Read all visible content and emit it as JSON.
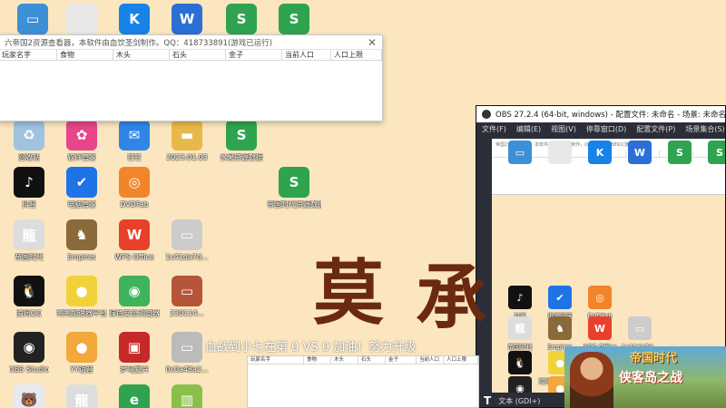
{
  "desktop": {
    "icons_top": [
      {
        "name": "computer-icon",
        "label": "",
        "color": "#3d8fd6",
        "glyph": "▭"
      },
      {
        "name": "file-icon",
        "label": "",
        "color": "#e8e8e8",
        "glyph": ""
      },
      {
        "name": "k-app-icon",
        "label": "",
        "color": "#1783e8",
        "glyph": "K"
      },
      {
        "name": "word-doc-icon",
        "label": "",
        "color": "#2b6fd6",
        "glyph": "W"
      },
      {
        "name": "spreadsheet-icon",
        "label": "",
        "color": "#2fa34f",
        "glyph": "S"
      },
      {
        "name": "spreadsheet-icon-2",
        "label": "",
        "color": "#2fa34f",
        "glyph": "S"
      }
    ],
    "icons_row2": [
      {
        "name": "recycle-bin-icon",
        "label": "回收站",
        "color": "#9fc3e0",
        "glyph": "♻"
      },
      {
        "name": "flower-app-icon",
        "label": "软件管家",
        "color": "#e8458b",
        "glyph": "✿"
      },
      {
        "name": "chat-app-icon",
        "label": "钉钉",
        "color": "#2f86e8",
        "glyph": "✉"
      },
      {
        "name": "folder-icon",
        "label": "2023.01.03",
        "color": "#e8b84a",
        "glyph": "▬"
      },
      {
        "name": "spreadsheet-data-icon",
        "label": "水果资源数据",
        "color": "#2fa34f",
        "glyph": "S"
      }
    ],
    "icons_row3": [
      {
        "name": "tiktok-icon",
        "label": "抖音",
        "color": "#111111",
        "glyph": "♪"
      },
      {
        "name": "shield-app-icon",
        "label": "电脑管家",
        "color": "#1e74e6",
        "glyph": "✔"
      },
      {
        "name": "dvd-tool-icon",
        "label": "DVDFab",
        "color": "#f0852a",
        "glyph": "◎"
      },
      {
        "name": "spreadsheet-data-icon-2",
        "label": "帝国时代资源数据",
        "color": "#2fa34f",
        "glyph": "S"
      }
    ],
    "icons_row4": [
      {
        "name": "dragon-app-icon",
        "label": "帝国时代",
        "color": "#dddddd",
        "glyph": "龍"
      },
      {
        "name": "game-char-icon",
        "label": "Empires",
        "color": "#8a6a3a",
        "glyph": "♞"
      },
      {
        "name": "wps-office-icon",
        "label": "WPS Office",
        "color": "#e8402a",
        "glyph": "W"
      },
      {
        "name": "image-file-icon",
        "label": "1c41da7d...",
        "color": "#cccccc",
        "glyph": "▭"
      }
    ],
    "icons_row5": [
      {
        "name": "qq-icon",
        "label": "腾讯QQ",
        "color": "#111111",
        "glyph": "🐧"
      },
      {
        "name": "duck-app-icon",
        "label": "鸭鸭加速器平台",
        "color": "#f2d23a",
        "glyph": "●"
      },
      {
        "name": "green-app-icon",
        "label": "绿色安全浏览器",
        "color": "#3fb35a",
        "glyph": "◉"
      },
      {
        "name": "game-thumb-icon",
        "label": "230114...",
        "color": "#b5553a",
        "glyph": "▭"
      }
    ],
    "icons_row6": [
      {
        "name": "obs-studio-icon",
        "label": "OBS Studio",
        "color": "#222222",
        "glyph": "◉"
      },
      {
        "name": "raccoon-app-icon",
        "label": "YY语音",
        "color": "#f2a83a",
        "glyph": "●"
      },
      {
        "name": "red-game-icon",
        "label": "罗马复兴",
        "color": "#c42a2a",
        "glyph": "▣"
      },
      {
        "name": "image-file-icon-2",
        "label": "0c0a48a2...",
        "color": "#bbbbbb",
        "glyph": "▭"
      }
    ],
    "icons_row7": [
      {
        "name": "bear-app-icon",
        "label": "",
        "color": "#e6eaf0",
        "glyph": "🐻"
      },
      {
        "name": "dragon-app-icon-2",
        "label": "",
        "color": "#dddddd",
        "glyph": "龍"
      },
      {
        "name": "ie-browser-icon",
        "label": "",
        "color": "#2fa34f",
        "glyph": "e"
      },
      {
        "name": "chart-file-icon",
        "label": "",
        "color": "#8ac04a",
        "glyph": "▥"
      }
    ]
  },
  "resource_window": {
    "title": "帝国2资源查看器，本软件由血饮圣剑制作。QQ：418733891(游戏已运行)",
    "title_prefix": "六",
    "columns": [
      "玩家名字",
      "食物",
      "木头",
      "石头",
      "金子",
      "当前人口",
      "人口上限"
    ]
  },
  "obs": {
    "title": "OBS 27.2.4 (64-bit, windows) - 配置文件: 未命名 - 场景: 未命名",
    "menus": [
      "文件(F)",
      "编辑(E)",
      "视图(V)",
      "停靠窗口(D)",
      "配置文件(P)",
      "场景集合(S)",
      "工具(T)"
    ],
    "bottom_label": "文本 (GDI+)"
  },
  "overlay": {
    "big_char": "莫",
    "big_char_2": "承",
    "ticker": "血战到小七在第 0 VS 0 加油！努力升级"
  },
  "bottom_table": {
    "columns": [
      "玩家名字",
      "食物",
      "木头",
      "石头",
      "金子",
      "当前人口",
      "人口上限"
    ]
  },
  "game_banner": {
    "title": "帝国时代",
    "subtitle": "侠客岛之战"
  }
}
